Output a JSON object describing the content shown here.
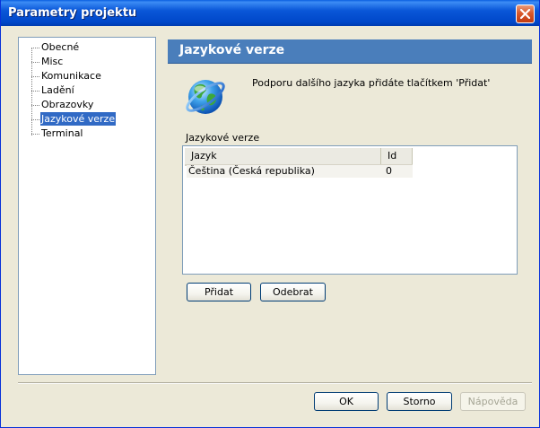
{
  "window": {
    "title": "Parametry projektu"
  },
  "tree": {
    "items": [
      {
        "label": "Obecné"
      },
      {
        "label": "Misc"
      },
      {
        "label": "Komunikace"
      },
      {
        "label": "Ladění"
      },
      {
        "label": "Obrazovky"
      },
      {
        "label": "Jazykové verze",
        "selected": true
      },
      {
        "label": "Terminal"
      }
    ]
  },
  "panel": {
    "title": "Jazykové verze",
    "hint": "Podporu dalšího jazyka přidáte tlačítkem 'Přidat'",
    "group_label": "Jazykové verze",
    "columns": [
      "Jazyk",
      "Id"
    ],
    "rows": [
      {
        "language": "Čeština (Česká republika)",
        "id": "0"
      }
    ],
    "add_label": "Přidat",
    "remove_label": "Odebrat"
  },
  "footer": {
    "ok_label": "OK",
    "cancel_label": "Storno",
    "help_label": "Nápověda"
  },
  "icons": {
    "close": "close-icon",
    "globe": "globe-icon"
  },
  "colors": {
    "titlebar": "#0054E3",
    "panel_header": "#4A7EBB",
    "selection": "#316AC5",
    "close_button": "#D9592B"
  }
}
